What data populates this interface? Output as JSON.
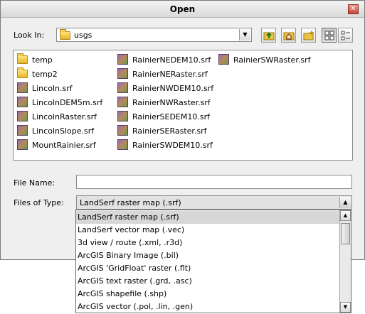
{
  "window": {
    "title": "Open",
    "close_glyph": "✕"
  },
  "look_in": {
    "label": "Look In:",
    "value": "usgs",
    "icon": "folder-icon"
  },
  "toolbar": {
    "buttons": [
      {
        "name": "up-one-level-button",
        "icon": "folder-up-icon"
      },
      {
        "name": "home-button",
        "icon": "home-folder-icon"
      },
      {
        "name": "new-folder-button",
        "icon": "new-folder-icon"
      },
      {
        "name": "list-view-button",
        "icon": "list-view-icon"
      },
      {
        "name": "details-view-button",
        "icon": "details-view-icon"
      }
    ]
  },
  "files": {
    "col1": [
      {
        "name": "temp",
        "type": "folder"
      },
      {
        "name": "temp2",
        "type": "folder"
      },
      {
        "name": "Lincoln.srf",
        "type": "srf"
      },
      {
        "name": "LincolnDEM5m.srf",
        "type": "srf"
      },
      {
        "name": "LincolnRaster.srf",
        "type": "srf"
      },
      {
        "name": "LincolnSlope.srf",
        "type": "srf"
      },
      {
        "name": "MountRainier.srf",
        "type": "srf"
      }
    ],
    "col2": [
      {
        "name": "RainierNEDEM10.srf",
        "type": "srf"
      },
      {
        "name": "RainierNERaster.srf",
        "type": "srf"
      },
      {
        "name": "RainierNWDEM10.srf",
        "type": "srf"
      },
      {
        "name": "RainierNWRaster.srf",
        "type": "srf"
      },
      {
        "name": "RainierSEDEM10.srf",
        "type": "srf"
      },
      {
        "name": "RainierSERaster.srf",
        "type": "srf"
      },
      {
        "name": "RainierSWDEM10.srf",
        "type": "srf"
      }
    ],
    "col3": [
      {
        "name": "RainierSWRaster.srf",
        "type": "srf"
      }
    ]
  },
  "file_name": {
    "label": "File Name:",
    "value": ""
  },
  "files_of_type": {
    "label": "Files of Type:",
    "value": "LandSerf raster map (.srf)",
    "options": [
      "LandSerf raster map (.srf)",
      "LandSerf vector map (.vec)",
      "3d view / route (.xml, .r3d)",
      "ArcGIS Binary Image (.bil)",
      "ArcGIS 'GridFloat' raster (.flt)",
      "ArcGIS text raster (.grd, .asc)",
      "ArcGIS shapefile (.shp)",
      "ArcGIS vector (.pol, .lin, .gen)"
    ],
    "selected_index": 0
  },
  "colors": {
    "dialog_bg": "#efefef",
    "selection": "#d7d7d7",
    "close_button": "#c0493b"
  }
}
